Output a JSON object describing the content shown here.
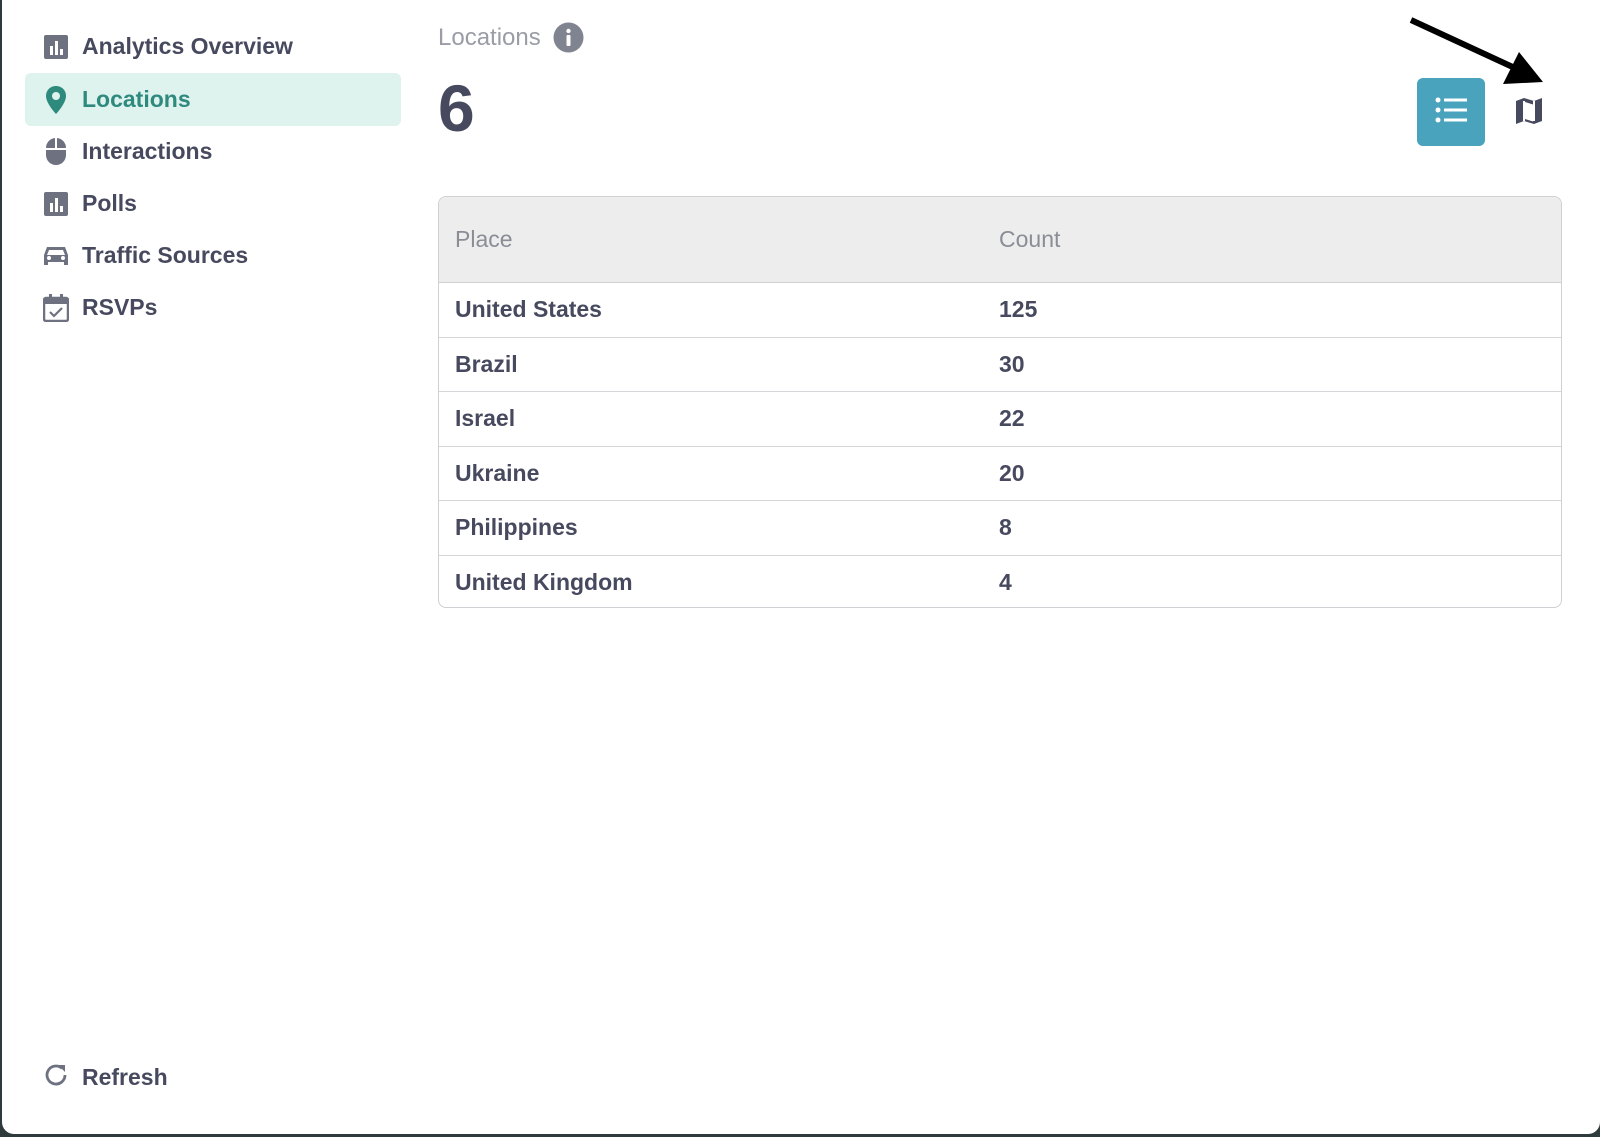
{
  "sidebar": {
    "items": [
      {
        "label": "Analytics Overview",
        "icon": "bar-chart-icon",
        "active": false
      },
      {
        "label": "Locations",
        "icon": "map-pin-icon",
        "active": true
      },
      {
        "label": "Interactions",
        "icon": "mouse-icon",
        "active": false
      },
      {
        "label": "Polls",
        "icon": "bar-chart-icon",
        "active": false
      },
      {
        "label": "Traffic Sources",
        "icon": "car-icon",
        "active": false
      },
      {
        "label": "RSVPs",
        "icon": "calendar-check-icon",
        "active": false
      }
    ],
    "refresh_label": "Refresh"
  },
  "header": {
    "title": "Locations",
    "count": "6"
  },
  "table": {
    "columns": [
      "Place",
      "Count"
    ],
    "rows": [
      {
        "place": "United States",
        "count": "125"
      },
      {
        "place": "Brazil",
        "count": "30"
      },
      {
        "place": "Israel",
        "count": "22"
      },
      {
        "place": "Ukraine",
        "count": "20"
      },
      {
        "place": "Philippines",
        "count": "8"
      },
      {
        "place": "United Kingdom",
        "count": "4"
      }
    ]
  },
  "colors": {
    "accent": "#4aa3bc",
    "active_bg": "#def2ee",
    "active_text": "#2f8a7e",
    "text": "#474a5e"
  }
}
